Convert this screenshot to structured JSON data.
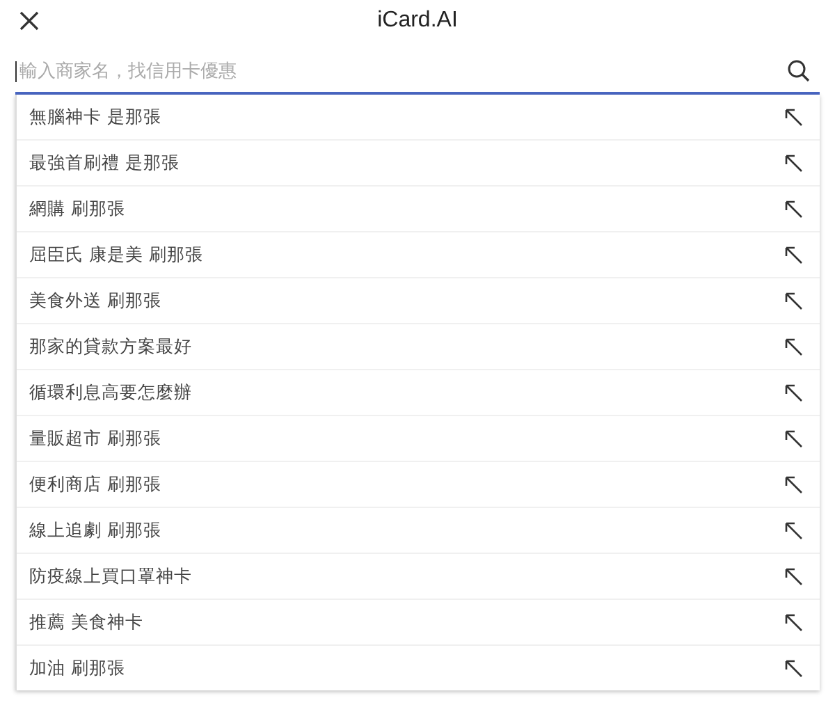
{
  "header": {
    "title": "iCard.AI"
  },
  "search": {
    "placeholder": "輸入商家名，找信用卡優惠"
  },
  "suggestions": [
    {
      "label": "無腦神卡 是那張"
    },
    {
      "label": "最強首刷禮 是那張"
    },
    {
      "label": "網購 刷那張"
    },
    {
      "label": "屈臣氏 康是美 刷那張"
    },
    {
      "label": "美食外送 刷那張"
    },
    {
      "label": "那家的貸款方案最好"
    },
    {
      "label": "循環利息高要怎麼辦"
    },
    {
      "label": "量販超市 刷那張"
    },
    {
      "label": "便利商店 刷那張"
    },
    {
      "label": "線上追劇 刷那張"
    },
    {
      "label": "防疫線上買口罩神卡"
    },
    {
      "label": "推薦 美食神卡"
    },
    {
      "label": "加油 刷那張"
    }
  ]
}
